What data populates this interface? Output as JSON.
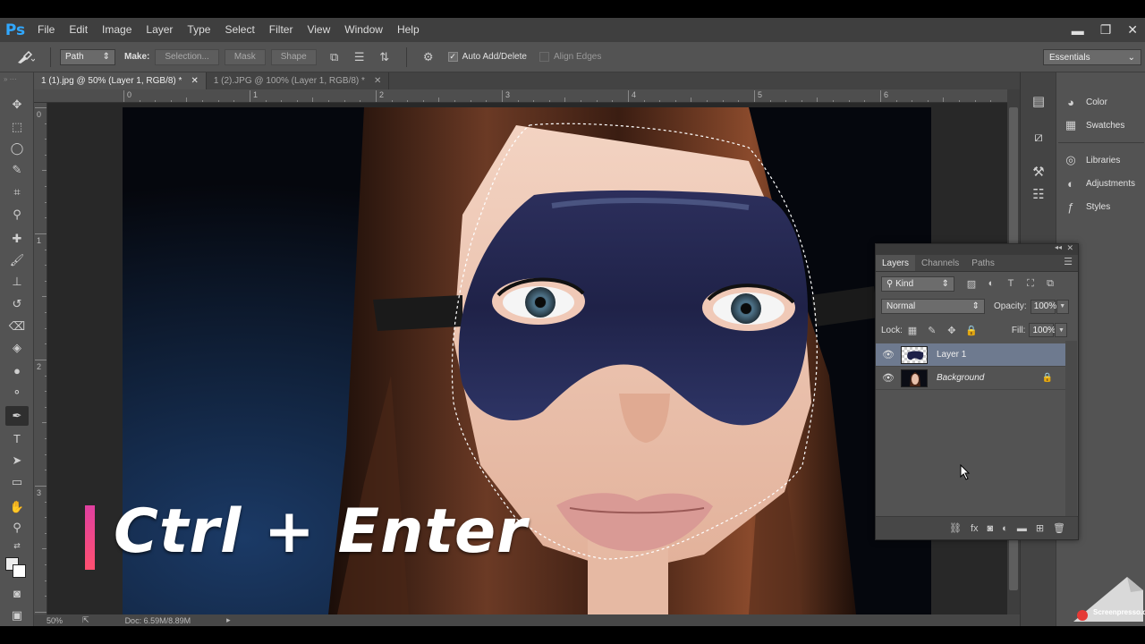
{
  "app": {
    "logo": "Ps"
  },
  "menu": [
    "File",
    "Edit",
    "Image",
    "Layer",
    "Type",
    "Select",
    "Filter",
    "View",
    "Window",
    "Help"
  ],
  "window_controls": {
    "minimize": "▬",
    "restore": "❐",
    "close": "✕"
  },
  "options": {
    "mode": "Path",
    "make_label": "Make:",
    "make_selection": "Selection...",
    "make_mask": "Mask",
    "make_shape": "Shape",
    "auto_add_delete": "Auto Add/Delete",
    "auto_add_delete_checked": true,
    "align_edges": "Align Edges",
    "align_edges_checked": false,
    "workspace": "Essentials"
  },
  "tabs": [
    {
      "label": "1 (1).jpg @ 50% (Layer 1, RGB/8) *",
      "active": true
    },
    {
      "label": "1 (2).JPG @ 100% (Layer 1, RGB/8) *",
      "active": false
    }
  ],
  "ruler": {
    "h_labels": [
      "0",
      "1",
      "2",
      "3",
      "4",
      "5",
      "6"
    ],
    "v_labels": [
      "0",
      "1",
      "2",
      "3"
    ]
  },
  "status": {
    "zoom": "50%",
    "doc": "Doc: 6.59M/8.89M"
  },
  "dock": {
    "items": [
      {
        "label": "Color",
        "icon": "color-icon"
      },
      {
        "label": "Swatches",
        "icon": "swatches-icon"
      },
      {
        "label": "Libraries",
        "icon": "libraries-icon"
      },
      {
        "label": "Adjustments",
        "icon": "adjustments-icon"
      },
      {
        "label": "Styles",
        "icon": "styles-icon"
      }
    ]
  },
  "layers_panel": {
    "tabs": [
      "Layers",
      "Channels",
      "Paths"
    ],
    "filter": "Kind",
    "blend_mode": "Normal",
    "opacity_label": "Opacity:",
    "opacity": "100%",
    "lock_label": "Lock:",
    "fill_label": "Fill:",
    "fill": "100%",
    "layers": [
      {
        "name": "Layer 1",
        "selected": true,
        "locked": false
      },
      {
        "name": "Background",
        "selected": false,
        "locked": true
      }
    ]
  },
  "overlay": {
    "caption": "Ctrl + Enter",
    "watermark": "Screenpresso.com"
  },
  "colors": {
    "accent": "#31a8ff",
    "selection": "#6e7a8f",
    "caption_bar": "#e040a0"
  }
}
